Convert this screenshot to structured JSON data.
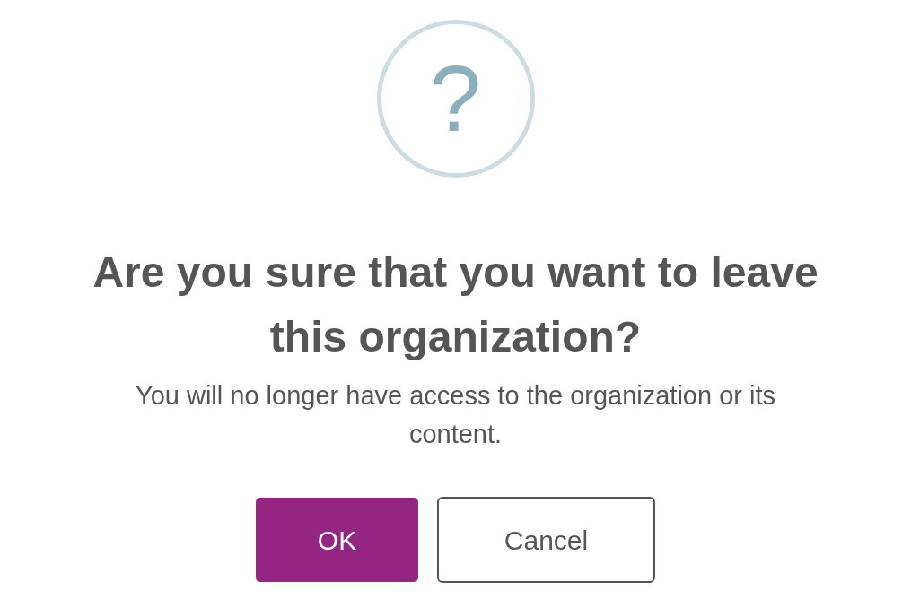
{
  "icon": {
    "glyph": "?"
  },
  "title": "Are you sure that you want to leave this organization?",
  "message": "You will no longer have access to the organization or its content.",
  "buttons": [
    {
      "label": "OK",
      "kind": "primary"
    },
    {
      "label": "Cancel",
      "kind": "secondary"
    }
  ]
}
